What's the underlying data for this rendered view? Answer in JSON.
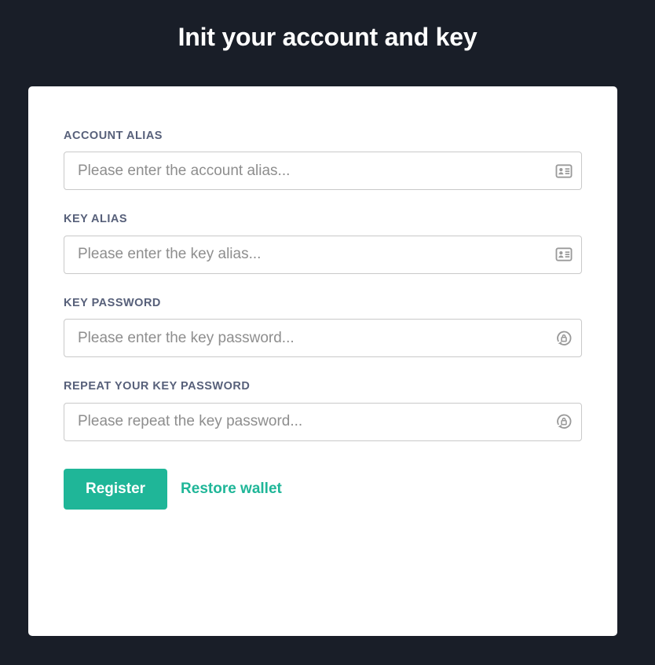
{
  "page": {
    "title": "Init your account and key",
    "background_color": "#191e28",
    "card_background_color": "#ffffff",
    "accent_color": "#1fb698",
    "label_color": "#57607a",
    "placeholder_color": "#8e8e8e",
    "input_border_color": "#c9c9c9"
  },
  "form": {
    "fields": [
      {
        "label": "ACCOUNT ALIAS",
        "placeholder": "Please enter the account alias...",
        "value": "",
        "type": "text",
        "icon": "id-card-icon"
      },
      {
        "label": "KEY ALIAS",
        "placeholder": "Please enter the key alias...",
        "value": "",
        "type": "text",
        "icon": "id-card-icon"
      },
      {
        "label": "KEY PASSWORD",
        "placeholder": "Please enter the key password...",
        "value": "",
        "type": "password",
        "icon": "lock-reset-icon"
      },
      {
        "label": "REPEAT YOUR KEY PASSWORD",
        "placeholder": "Please repeat the key password...",
        "value": "",
        "type": "password",
        "icon": "lock-reset-icon"
      }
    ],
    "actions": {
      "submit_label": "Register",
      "restore_label": "Restore wallet"
    }
  }
}
